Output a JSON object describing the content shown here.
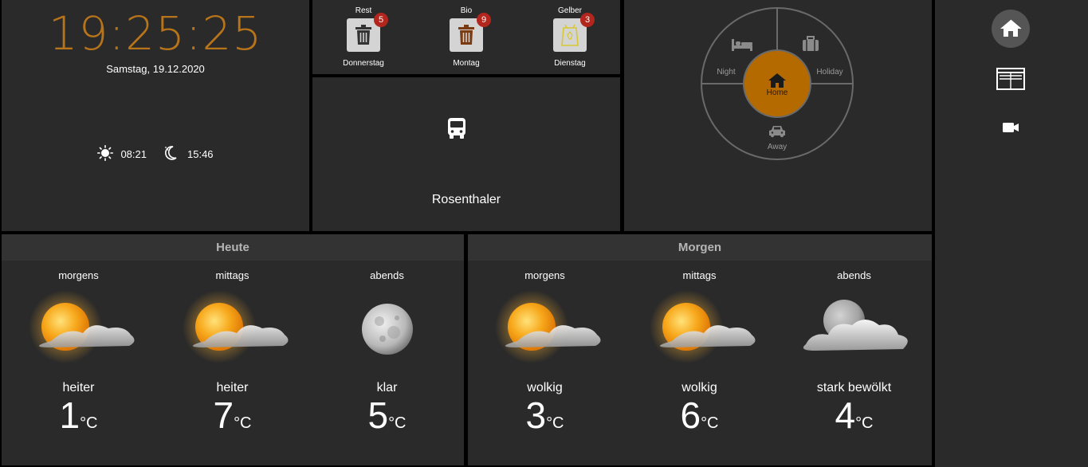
{
  "clock": {
    "time": "19:25:25",
    "date": "Samstag, 19.12.2020",
    "sunrise": "08:21",
    "sunset": "15:46"
  },
  "trash": [
    {
      "name": "Rest",
      "count": "5",
      "day": "Donnerstag",
      "color": "#333333"
    },
    {
      "name": "Bio",
      "count": "9",
      "day": "Montag",
      "color": "#7a3a12"
    },
    {
      "name": "Gelber",
      "count": "3",
      "day": "Dienstag",
      "color": "#d8c830"
    }
  ],
  "transit": {
    "stop": "Rosenthaler",
    "icon": "bus-icon"
  },
  "mode": {
    "night": "Night",
    "holiday": "Holiday",
    "home": "Home",
    "away": "Away",
    "active": "Home",
    "active_color": "#b56a00"
  },
  "sidebar": {
    "items": [
      "home-icon",
      "blinds-icon",
      "camera-icon"
    ]
  },
  "weather": {
    "today": {
      "title": "Heute",
      "periods": [
        {
          "label": "morgens",
          "desc": "heiter",
          "temp": "1",
          "unit": "°C",
          "icon": "sun-cloud-icon"
        },
        {
          "label": "mittags",
          "desc": "heiter",
          "temp": "7",
          "unit": "°C",
          "icon": "sun-cloud-icon"
        },
        {
          "label": "abends",
          "desc": "klar",
          "temp": "5",
          "unit": "°C",
          "icon": "moon-icon"
        }
      ]
    },
    "tomorrow": {
      "title": "Morgen",
      "periods": [
        {
          "label": "morgens",
          "desc": "wolkig",
          "temp": "3",
          "unit": "°C",
          "icon": "sun-cloud-icon"
        },
        {
          "label": "mittags",
          "desc": "wolkig",
          "temp": "6",
          "unit": "°C",
          "icon": "sun-cloud-icon"
        },
        {
          "label": "abends",
          "desc": "stark bewölkt",
          "temp": "4",
          "unit": "°C",
          "icon": "moon-cloud-icon"
        }
      ]
    }
  }
}
